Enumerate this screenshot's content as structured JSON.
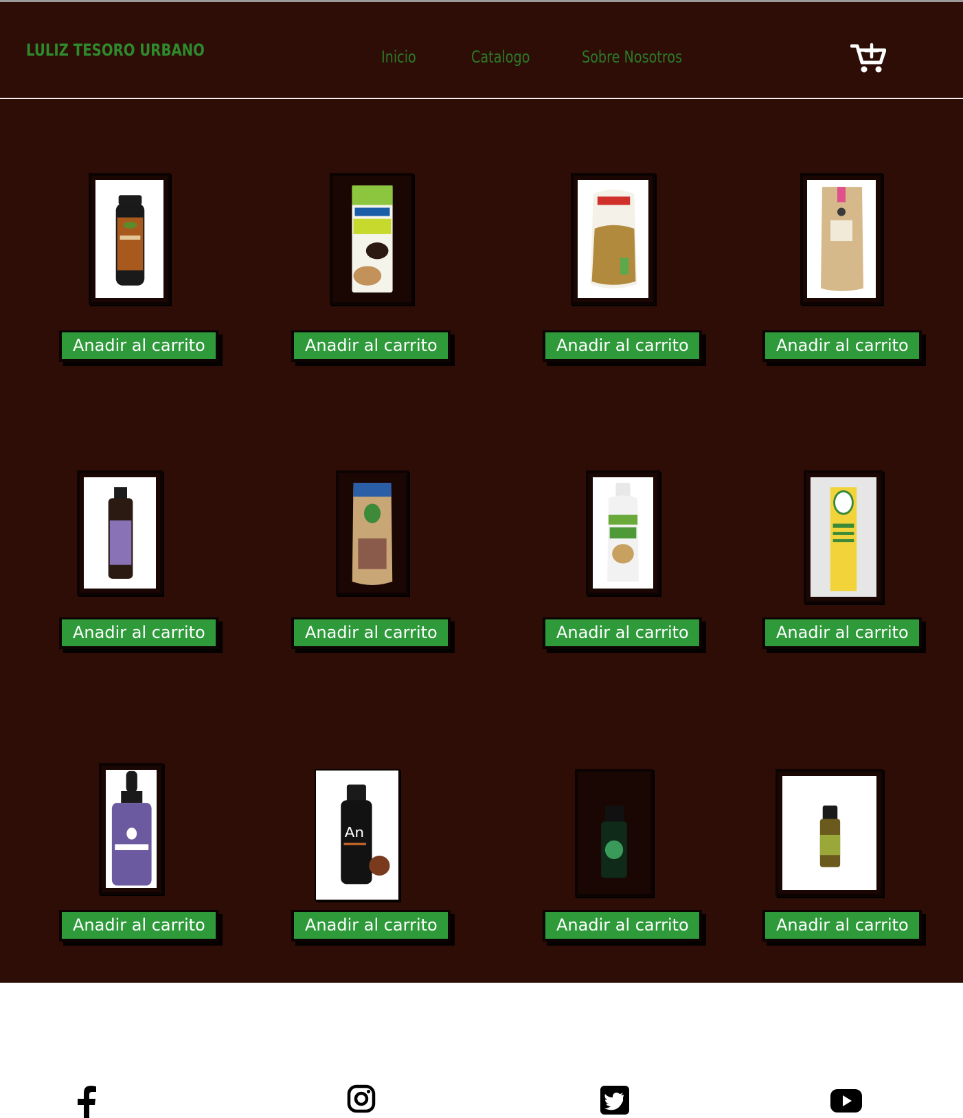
{
  "brand": {
    "name": "LULIZ TESORO URBANO",
    "accent": "#2e9a3a",
    "background": "#2d0d06"
  },
  "nav": {
    "items": [
      {
        "label": "Inicio"
      },
      {
        "label": "Catalogo"
      },
      {
        "label": "Sobre Nosotros"
      }
    ],
    "cart_icon": "cart-add-icon"
  },
  "products": [
    {
      "image": "organic-spice-jar",
      "button": "Anadir al carrito"
    },
    {
      "image": "coffee-pouch",
      "button": "Anadir al carrito"
    },
    {
      "image": "seed-pouch",
      "button": "Anadir al carrito"
    },
    {
      "image": "kraft-pouch",
      "button": "Anadir al carrito"
    },
    {
      "image": "lavender-oil-bottle",
      "button": "Anadir al carrito"
    },
    {
      "image": "cacao-powder-pouch",
      "button": "Anadir al carrito"
    },
    {
      "image": "ginger-bottle",
      "button": "Anadir al carrito"
    },
    {
      "image": "booster-box",
      "button": "Anadir al carrito"
    },
    {
      "image": "lavanda-dropper-bottle",
      "button": "Anadir al carrito"
    },
    {
      "image": "anis-oil-bottle",
      "button": "Anadir al carrito"
    },
    {
      "image": "essential-oil-vial",
      "button": "Anadir al carrito"
    },
    {
      "image": "green-oil-bottle",
      "button": "Anadir al carrito"
    }
  ],
  "footer": {
    "social": [
      "facebook-icon",
      "instagram-icon",
      "twitter-icon",
      "youtube-icon"
    ]
  }
}
